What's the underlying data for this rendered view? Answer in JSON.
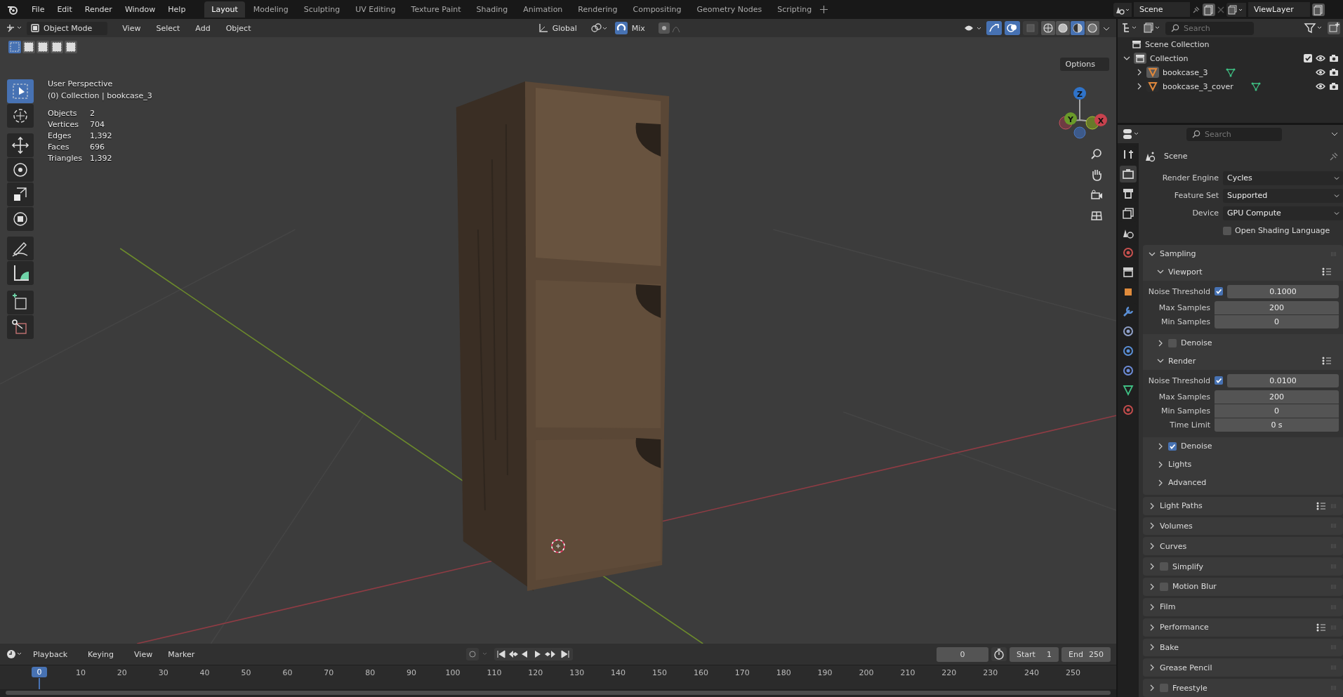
{
  "menu": [
    "File",
    "Edit",
    "Render",
    "Window",
    "Help"
  ],
  "workspaces": [
    {
      "label": "Layout",
      "selected": true
    },
    {
      "label": "Modeling",
      "selected": false
    },
    {
      "label": "Sculpting",
      "selected": false
    },
    {
      "label": "UV Editing",
      "selected": false
    },
    {
      "label": "Texture Paint",
      "selected": false
    },
    {
      "label": "Shading",
      "selected": false
    },
    {
      "label": "Animation",
      "selected": false
    },
    {
      "label": "Rendering",
      "selected": false
    },
    {
      "label": "Compositing",
      "selected": false
    },
    {
      "label": "Geometry Nodes",
      "selected": false
    },
    {
      "label": "Scripting",
      "selected": false
    }
  ],
  "scene": "Scene",
  "view_layer": "ViewLayer",
  "viewport": {
    "mode": "Object Mode",
    "menus": [
      "View",
      "Select",
      "Add",
      "Object"
    ],
    "orientation": "Global",
    "snap_target": "Mix",
    "options": "Options",
    "select_modes": [
      {
        "selected": true
      },
      {
        "selected": false
      },
      {
        "selected": false
      },
      {
        "selected": false
      },
      {
        "selected": false
      }
    ],
    "toggles": [
      {
        "kind": "gizmo",
        "on": true
      },
      {
        "kind": "overlay",
        "on": true
      },
      {
        "kind": "xray",
        "on": false
      }
    ],
    "shading": [
      {
        "kind": "wireframe",
        "selected": false
      },
      {
        "kind": "solid",
        "selected": false
      },
      {
        "kind": "material",
        "selected": true
      },
      {
        "kind": "rendered",
        "selected": false
      }
    ],
    "title": "User Perspective",
    "context": "(0) Collection | bookcase_3",
    "stats": [
      {
        "label": "Objects",
        "value": "2"
      },
      {
        "label": "Vertices",
        "value": "704"
      },
      {
        "label": "Edges",
        "value": "1,392"
      },
      {
        "label": "Faces",
        "value": "696"
      },
      {
        "label": "Triangles",
        "value": "1,392"
      }
    ],
    "gizmo": {
      "z": "Z",
      "y": "Y",
      "x": "X"
    },
    "tool_groups": [
      {
        "tools": [
          {
            "kind": "select",
            "selected": true
          },
          {
            "kind": "cursor",
            "selected": false
          }
        ]
      },
      {
        "tools": [
          {
            "kind": "move",
            "selected": false
          },
          {
            "kind": "rotate",
            "selected": false
          },
          {
            "kind": "scale",
            "selected": false
          },
          {
            "kind": "transform",
            "selected": false
          }
        ]
      },
      {
        "tools": [
          {
            "kind": "annotate",
            "selected": false
          },
          {
            "kind": "measure",
            "selected": false
          }
        ]
      },
      {
        "tools": [
          {
            "kind": "add_cube",
            "selected": false
          },
          {
            "kind": "cut",
            "selected": false
          }
        ]
      }
    ]
  },
  "outliner": {
    "search_placeholder": "Search",
    "root": "Scene Collection",
    "collection": {
      "name": "Collection",
      "expanded": true,
      "checked": true,
      "children": [
        {
          "name": "bookcase_3",
          "selected": true,
          "expanded": false
        },
        {
          "name": "bookcase_3_cover",
          "selected": false,
          "expanded": false
        }
      ]
    }
  },
  "properties": {
    "search_placeholder": "Search",
    "context": "Scene",
    "tabs": [
      {
        "kind": "tool",
        "selected": false
      },
      {
        "kind": "render",
        "selected": true
      },
      {
        "kind": "output",
        "selected": false
      },
      {
        "kind": "view_layer",
        "selected": false
      },
      {
        "kind": "scene",
        "selected": false
      },
      {
        "kind": "world",
        "selected": false
      },
      {
        "kind": "collection",
        "selected": false
      },
      {
        "kind": "object",
        "selected": false
      },
      {
        "kind": "modifiers",
        "selected": false
      },
      {
        "kind": "particles",
        "selected": false
      },
      {
        "kind": "physics",
        "selected": false
      },
      {
        "kind": "constraints",
        "selected": false
      },
      {
        "kind": "data",
        "selected": false
      },
      {
        "kind": "material",
        "selected": false
      }
    ],
    "fields": [
      {
        "label": "Render Engine",
        "value": "Cycles"
      },
      {
        "label": "Feature Set",
        "value": "Supported"
      },
      {
        "label": "Device",
        "value": "GPU Compute"
      }
    ],
    "osl": {
      "label": "Open Shading Language",
      "checked": false
    },
    "sampling": {
      "title": "Sampling",
      "expanded": true,
      "subpanels": [
        {
          "title": "Viewport",
          "expanded": true,
          "presets": true,
          "noise": {
            "label": "Noise Threshold",
            "checked": true,
            "value": "0.1000"
          },
          "rows": [
            {
              "label": "Max Samples",
              "value": "200"
            },
            {
              "label": "Min Samples",
              "value": "0"
            }
          ],
          "after": [
            {
              "title": "Denoise",
              "kind": "toggle",
              "checked": false,
              "expanded": false
            }
          ]
        },
        {
          "title": "Render",
          "expanded": true,
          "presets": true,
          "noise": {
            "label": "Noise Threshold",
            "checked": true,
            "value": "0.0100"
          },
          "rows": [
            {
              "label": "Max Samples",
              "value": "200"
            },
            {
              "label": "Min Samples",
              "value": "0"
            },
            {
              "label": "Time Limit",
              "value": "0 s"
            }
          ],
          "after": [
            {
              "title": "Denoise",
              "kind": "toggle",
              "checked": true,
              "expanded": false
            },
            {
              "title": "Lights",
              "kind": "plain",
              "expanded": false
            },
            {
              "title": "Advanced",
              "kind": "plain",
              "expanded": false
            }
          ]
        }
      ]
    },
    "panels": [
      {
        "title": "Light Paths",
        "kind": "plain",
        "presets": true,
        "expanded": false
      },
      {
        "title": "Volumes",
        "kind": "plain",
        "presets": false,
        "expanded": false
      },
      {
        "title": "Curves",
        "kind": "plain",
        "presets": false,
        "expanded": false
      },
      {
        "title": "Simplify",
        "kind": "toggle",
        "checked": false,
        "presets": false,
        "expanded": false
      },
      {
        "title": "Motion Blur",
        "kind": "toggle",
        "checked": false,
        "presets": false,
        "expanded": false
      },
      {
        "title": "Film",
        "kind": "plain",
        "presets": false,
        "expanded": false
      },
      {
        "title": "Performance",
        "kind": "plain",
        "presets": true,
        "expanded": false
      },
      {
        "title": "Bake",
        "kind": "plain",
        "presets": false,
        "expanded": false
      },
      {
        "title": "Grease Pencil",
        "kind": "plain",
        "presets": false,
        "expanded": false
      },
      {
        "title": "Freestyle",
        "kind": "toggle",
        "checked": false,
        "presets": false,
        "expanded": false
      }
    ]
  },
  "timeline": {
    "menus": [
      "Playback",
      "Keying",
      "View",
      "Marker"
    ],
    "current_frame": "0",
    "start_label": "Start",
    "start": "1",
    "end_label": "End",
    "end": "250",
    "playhead": "0",
    "ticks": [
      "10",
      "20",
      "30",
      "40",
      "50",
      "60",
      "70",
      "80",
      "90",
      "100",
      "110",
      "120",
      "130",
      "140",
      "150",
      "160",
      "170",
      "180",
      "190",
      "200",
      "210",
      "220",
      "230",
      "240",
      "250"
    ]
  }
}
